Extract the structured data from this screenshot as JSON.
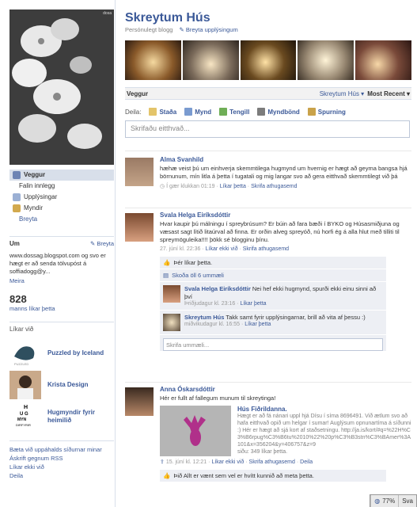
{
  "page": {
    "title": "Skreytum Hús",
    "category": "Persónulegt blogg",
    "edit_info": "Breyta upplýsingum"
  },
  "left_nav": {
    "photo_watermark": "dosa",
    "items": [
      {
        "label": "Veggur",
        "active": true
      },
      {
        "label": "Falin innlegg"
      },
      {
        "label": "Upplýsingar"
      },
      {
        "label": "Myndir"
      },
      {
        "label": "Breyta"
      }
    ]
  },
  "about": {
    "heading": "Um",
    "edit": "Breyta",
    "text": "www.dossag.blogspot.com og svo er hægt er að senda tölvupóst á soffiadogg@y...",
    "more": "Meira"
  },
  "likes": {
    "count": "828",
    "count_label": "manns líkar þetta",
    "heading": "Líkar við",
    "items": [
      {
        "name": "Puzzled by Iceland"
      },
      {
        "name": "Krista Design"
      },
      {
        "name": "Hugmyndir fyrir heimilið"
      }
    ]
  },
  "bottom_links": [
    "Bæta við uppáhalds síðurnar minar",
    "Áskrift gegnum RSS",
    "Líkar ekki við",
    "Deila"
  ],
  "wall_bar": {
    "label": "Veggur",
    "filter_name": "Skreytum Hús",
    "sort": "Most Recent"
  },
  "share": {
    "label": "Deila:",
    "items": [
      "Staða",
      "Mynd",
      "Tengill",
      "Myndbönd",
      "Spurning"
    ]
  },
  "composer": {
    "placeholder": "Skrifaðu eitthvað..."
  },
  "posts": [
    {
      "author": "Alma Svanhild",
      "message": "hæhæ veist þú um einhverja skemmtilega hugmynd um hvernig er hægt að geyma bangsa hjá börnunum, mín litla á þetta í tugatali og mig langar svo að gera eitthvað skemmtilegt við þá",
      "time": "Í gær klukkan 01:19",
      "actions": [
        "Líkar þetta",
        "Skrifa athugasemd"
      ]
    },
    {
      "author": "Svala Helga Eiríksdóttir",
      "message": "Hvar kaupir þú málningu í spreybrúsum? Er búin að fara bæði í BYKO og Húsasmiðjuna og væsast sagt lítið litaúrval að finna. Er orðin alveg spreyóð, nú horfi ég á alla hlut með tilliti til spreymöguleika!!!! þökk sé blogginu þínu.",
      "time": "27. júní kl. 22:36",
      "actions": [
        "Líkar ekki við",
        "Skrifa athugasemd"
      ],
      "like_line": "Þér líkar þetta.",
      "view_all": "Skoða öll 6 ummæli",
      "comments": [
        {
          "author": "Svala Helga Eiríksdóttir",
          "text": "Nei hef ekki hugmynd, spurði ekki einu sinni að því",
          "time": "Þriðjudagur kl. 23:16",
          "action": "Líkar þetta"
        },
        {
          "author": "Skreytum Hús",
          "text": "Takk samt fyrir upplýsingarnar, brill að vita af þessu :)",
          "time": "miðvikudagur kl. 16:55",
          "action": "Líkar þetta"
        }
      ],
      "comment_placeholder": "Skrifa ummæli..."
    },
    {
      "author": "Anna Óskarsdóttir",
      "message": "Hér er fullt af fallegum munum til skreytinga!",
      "attachment": {
        "title": "Hús Fiðrildanna.",
        "desc": "Hægt er að fá nánari uppl hjá Dísu í síma 8696491. Við ætlum svo að hafa eitthvað opið um helgar í sumar! Auglýsum opnunartíma á síðunni :) Hér er hægt að sjá kort af staðsetningu. http://ja.is/kort/#q=%22H%C3%B6rpug%C3%B6tu%2010%22%20p%C3%B3stn%C3%BAmer%3A101&x=356204&y=406757&z=9",
        "likes": "siðu: 349 líkar þetta."
      },
      "time": "15. júní kl. 12:21",
      "actions": [
        "Líkar ekki við",
        "Skrifa athugasemd",
        "Deila"
      ],
      "like_line": "Þið Allt er vænt sem vel er hvítt kunnið að meta þetta."
    }
  ],
  "chat_bar": {
    "percent": "77%",
    "label": "Sva"
  },
  "colors": {
    "brand": "#3b5998",
    "nav_active": "#d8dfea",
    "comment_bg": "#edeff4"
  }
}
